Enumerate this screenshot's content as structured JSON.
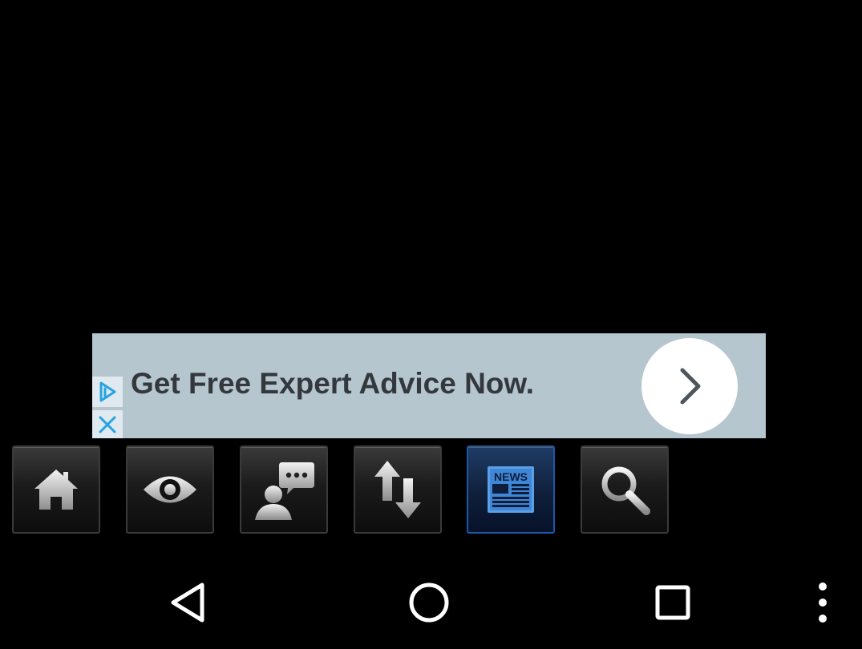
{
  "ad": {
    "headline": "Get Free Expert Advice Now.",
    "bg_color": "#b6c6cf",
    "adchoices_icon": "adchoices-icon",
    "close_icon": "close-icon",
    "arrow_icon": "chevron-right-icon"
  },
  "toolbar": {
    "buttons": [
      {
        "icon": "home-icon"
      },
      {
        "icon": "eye-icon"
      },
      {
        "icon": "chat-user-icon"
      },
      {
        "icon": "up-down-arrows-icon"
      },
      {
        "icon": "news-icon",
        "active": true,
        "label": "NEWS"
      },
      {
        "icon": "search-icon"
      }
    ],
    "active_color": "#1d57a8"
  },
  "navbar": {
    "buttons": [
      "back-icon",
      "home-circle-icon",
      "recents-icon",
      "overflow-menu-icon"
    ]
  }
}
